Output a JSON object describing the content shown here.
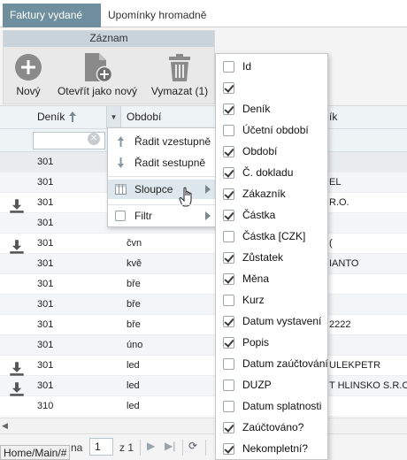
{
  "tabs": [
    {
      "label": "Faktury vydané",
      "active": true
    },
    {
      "label": "Upomínky hromadně",
      "active": false
    }
  ],
  "ribbon": {
    "group_title": "Záznam",
    "buttons": [
      {
        "label": "Nový",
        "icon": "plus-circle-icon"
      },
      {
        "label": "Otevřít jako nový",
        "icon": "document-add-icon"
      },
      {
        "label": "Vymazat (1)",
        "icon": "trash-icon"
      }
    ]
  },
  "grid": {
    "columns": [
      {
        "label": "Deník",
        "sort": "ascending"
      },
      {
        "label": "Období"
      },
      {
        "label": "ík"
      }
    ],
    "rows": [
      {
        "icon": "",
        "denik": "301",
        "obdobi": "",
        "right": ""
      },
      {
        "icon": "",
        "denik": "301",
        "obdobi": "",
        "right": "EL"
      },
      {
        "icon": "download-icon",
        "denik": "301",
        "obdobi": "",
        "right": "R.O."
      },
      {
        "icon": "",
        "denik": "301",
        "obdobi": "",
        "right": ""
      },
      {
        "icon": "download-icon",
        "denik": "301",
        "obdobi": "čvn",
        "right": "("
      },
      {
        "icon": "",
        "denik": "301",
        "obdobi": "kvě",
        "right": "IANTO"
      },
      {
        "icon": "",
        "denik": "301",
        "obdobi": "bře",
        "right": ""
      },
      {
        "icon": "",
        "denik": "301",
        "obdobi": "bře",
        "right": ""
      },
      {
        "icon": "",
        "denik": "301",
        "obdobi": "bře",
        "right": "2222"
      },
      {
        "icon": "",
        "denik": "301",
        "obdobi": "úno",
        "right": ""
      },
      {
        "icon": "download-icon",
        "denik": "301",
        "obdobi": "led",
        "right": "ULEKPETR"
      },
      {
        "icon": "download-icon",
        "denik": "301",
        "obdobi": "led",
        "right": "T HLINSKO S.R.O"
      },
      {
        "icon": "",
        "denik": "310",
        "obdobi": "led",
        "right": ""
      }
    ]
  },
  "context_menu": {
    "items": [
      {
        "label": "Řadit vzestupně",
        "icon": "sort-asc-icon"
      },
      {
        "label": "Řadit sestupně",
        "icon": "sort-desc-icon"
      },
      {
        "label": "Sloupce",
        "icon": "columns-icon",
        "submenu": true,
        "highlighted": true
      },
      {
        "label": "Filtr",
        "icon": "checkbox-icon",
        "submenu": true
      }
    ]
  },
  "column_chooser": [
    {
      "label": "Id",
      "checked": false
    },
    {
      "label": "",
      "checked": true
    },
    {
      "label": "Deník",
      "checked": true
    },
    {
      "label": "Účetní období",
      "checked": false
    },
    {
      "label": "Období",
      "checked": true
    },
    {
      "label": "Č. dokladu",
      "checked": true
    },
    {
      "label": "Zákazník",
      "checked": true
    },
    {
      "label": "Částka",
      "checked": true
    },
    {
      "label": "Částka [CZK]",
      "checked": false
    },
    {
      "label": "Zůstatek",
      "checked": true
    },
    {
      "label": "Měna",
      "checked": true
    },
    {
      "label": "Kurz",
      "checked": false
    },
    {
      "label": "Datum vystavení",
      "checked": true
    },
    {
      "label": "Popis",
      "checked": true
    },
    {
      "label": "Datum zaúčtování",
      "checked": false
    },
    {
      "label": "DUZP",
      "checked": false
    },
    {
      "label": "Datum splatnosti",
      "checked": false
    },
    {
      "label": "Zaúčtováno?",
      "checked": true
    },
    {
      "label": "Nekompletní?",
      "checked": true
    }
  ],
  "pager": {
    "prefix": "na",
    "page": "1",
    "of_label": "z 1"
  },
  "status_path": "Home/Main/#",
  "colors": {
    "active_tab": "#6f8f9f",
    "ribbon_group_header": "#c8d3dc",
    "icon_gray": "#8a8a8a"
  }
}
